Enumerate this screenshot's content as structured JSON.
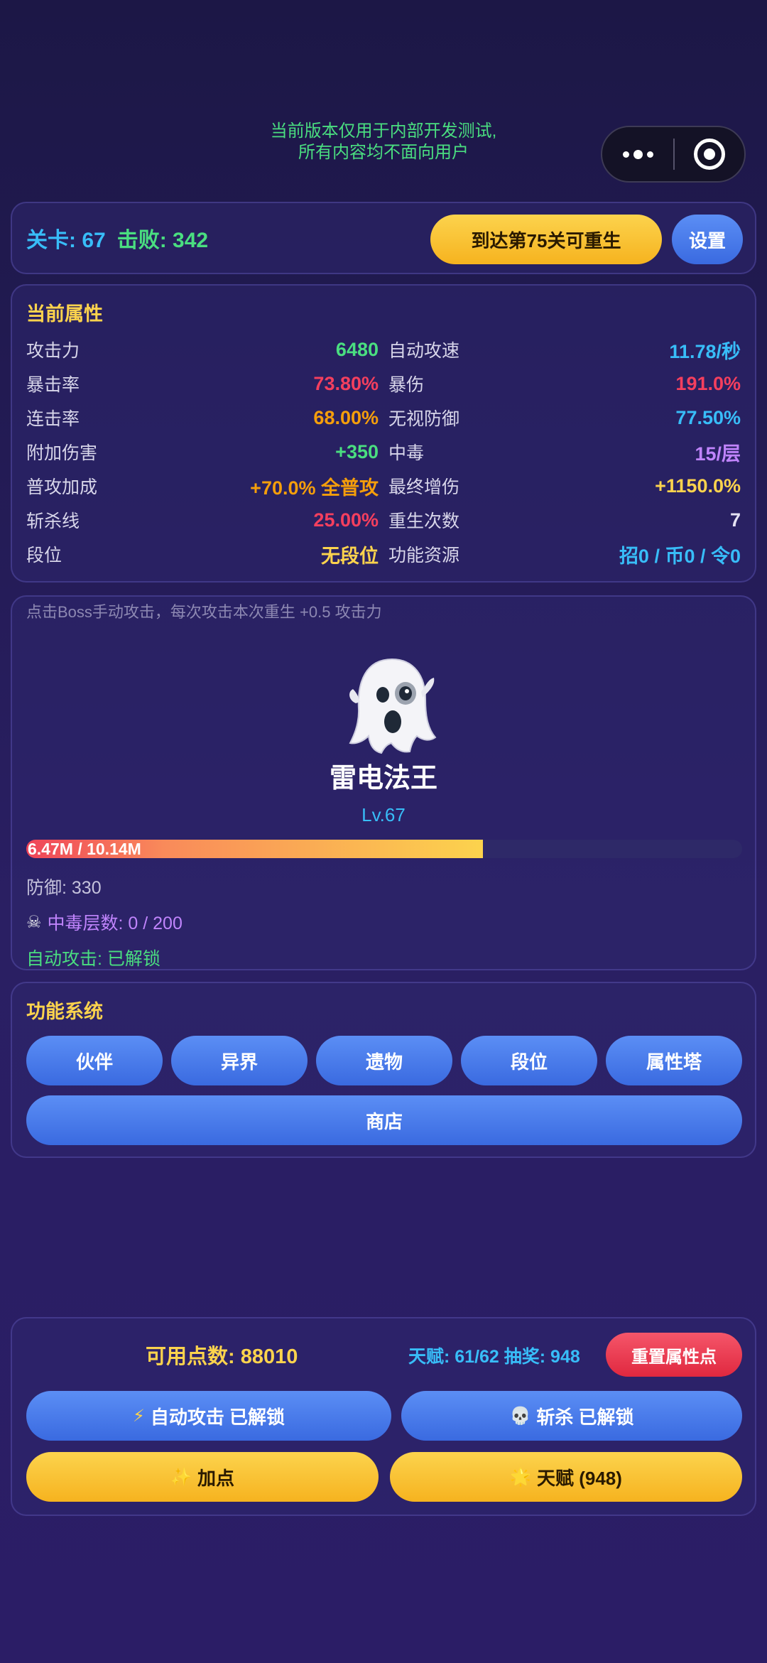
{
  "notice": {
    "line1": "当前版本仅用于内部开发测试,",
    "line2": "所有内容均不面向用户"
  },
  "top_bar": {
    "stage": "关卡: 67",
    "kills": "击败: 342",
    "rebirth_label": "到达第75关可重生",
    "settings_label": "设置"
  },
  "attributes": {
    "title": "当前属性",
    "left": [
      {
        "label": "攻击力",
        "value": "6480",
        "color": "#4ade80"
      },
      {
        "label": "暴击率",
        "value": "73.80%",
        "color": "#f43f5e"
      },
      {
        "label": "连击率",
        "value": "68.00%",
        "color": "#f59e0b"
      },
      {
        "label": "附加伤害",
        "value": "+350",
        "color": "#4ade80"
      },
      {
        "label": "普攻加成",
        "value": "+70.0% 全普攻",
        "color": "#f59e0b"
      },
      {
        "label": "斩杀线",
        "value": "25.00%",
        "color": "#f43f5e"
      },
      {
        "label": "段位",
        "value": "无段位",
        "color": "#fcd34d"
      }
    ],
    "right": [
      {
        "label": "自动攻速",
        "value": "11.78/秒",
        "color": "#38bdf8"
      },
      {
        "label": "暴伤",
        "value": "191.0%",
        "color": "#f43f5e"
      },
      {
        "label": "无视防御",
        "value": "77.50%",
        "color": "#38bdf8"
      },
      {
        "label": "中毒",
        "value": "15/层",
        "color": "#c084fc"
      },
      {
        "label": "最终增伤",
        "value": "+1150.0%",
        "color": "#fcd34d"
      },
      {
        "label": "重生次数",
        "value": "7",
        "color": "#e5e3f3"
      },
      {
        "label": "功能资源",
        "value": "招0 / 币0 / 令0",
        "color": "#38bdf8"
      }
    ]
  },
  "boss": {
    "hint": "点击Boss手动攻击，每次攻击本次重生 +0.5 攻击力",
    "icon": "ghost-icon",
    "name": "雷电法王",
    "level": "Lv.67",
    "hp_text": "6.47M / 10.14M",
    "hp_fraction": 0.638,
    "defense": "防御: 330",
    "poison": "中毒层数: 0 / 200",
    "auto_attack": "自动攻击: 已解锁"
  },
  "features": {
    "title": "功能系统",
    "buttons": [
      "伙伴",
      "异界",
      "遗物",
      "段位",
      "属性塔"
    ],
    "shop_label": "商店"
  },
  "bottom": {
    "points": "可用点数: 88010",
    "talent_info": "天赋: 61/62  抽奖: 948",
    "reset_label": "重置属性点",
    "auto_attack_label": "自动攻击 已解锁",
    "execute_label": "斩杀 已解锁",
    "add_points_label": "加点",
    "talent_label": "天赋 (948)"
  }
}
